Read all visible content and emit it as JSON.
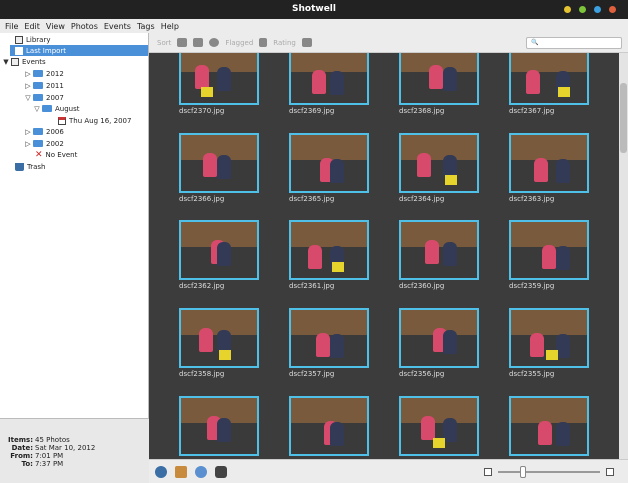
{
  "window": {
    "title": "Shotwell"
  },
  "menu": [
    "File",
    "Edit",
    "View",
    "Photos",
    "Events",
    "Tags",
    "Help"
  ],
  "sidebar": {
    "library": "Library",
    "last_import": "Last Import",
    "events": "Events",
    "years": [
      "2012",
      "2011",
      "2007",
      "2006",
      "2002"
    ],
    "month": "August",
    "day": "Thu Aug 16, 2007",
    "no_event": "No Event",
    "trash": "Trash"
  },
  "info": {
    "items_label": "Items:",
    "items_value": "45 Photos",
    "date_label": "Date:",
    "date_value": "Sat Mar 10, 2012",
    "from_label": "From:",
    "from_value": "7:01 PM",
    "to_label": "To:",
    "to_value": "7:37 PM"
  },
  "toolbar": {
    "sort": "Sort",
    "flagged": "Flagged",
    "rating": "Rating",
    "search_placeholder": ""
  },
  "photos": [
    "dscf2370.jpg",
    "dscf2369.jpg",
    "dscf2368.jpg",
    "dscf2367.jpg",
    "dscf2366.jpg",
    "dscf2365.jpg",
    "dscf2364.jpg",
    "dscf2363.jpg",
    "dscf2362.jpg",
    "dscf2361.jpg",
    "dscf2360.jpg",
    "dscf2359.jpg",
    "dscf2358.jpg",
    "dscf2357.jpg",
    "dscf2356.jpg",
    "dscf2355.jpg",
    "",
    "",
    "",
    ""
  ],
  "colors": {
    "selection": "#4a90d9",
    "thumb_border": "#4fc1e9",
    "viewer_bg": "#3c3c3c"
  }
}
